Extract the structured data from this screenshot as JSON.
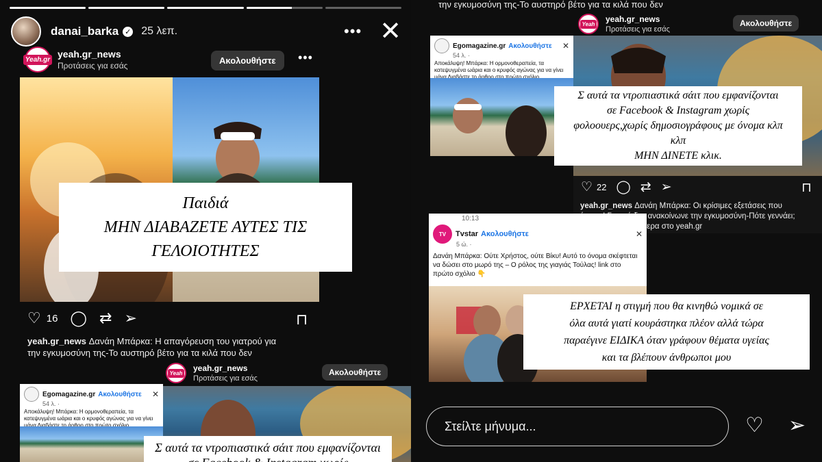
{
  "left_story": {
    "progress": [
      1,
      1,
      1,
      0.6,
      0
    ],
    "user": "danai_barka",
    "time": "25 λεπ.",
    "more": "•••",
    "close": "✕"
  },
  "post1": {
    "user": "yeah.gr_news",
    "subtitle": "Προτάσεις για εσάς",
    "follow": "Ακολουθήστε",
    "more": "•••",
    "logo_text": "Yeah.gr",
    "overlay_lines": [
      "Παιδιά",
      "ΜΗΝ ΔΙΑΒΑΖΕΤΕ ΑΥΤΕΣ ΤΙΣ",
      "ΓΕΛΟΙΟΤΗΤΕΣ"
    ],
    "likes": "16",
    "caption_user": "yeah.gr_news",
    "caption_line1": "Δανάη Μπάρκα: Η απαγόρευση του γιατρού για",
    "caption_line2": "την εγκυμοσύνη της-Το αυστηρό βέτο για τα κιλά που δεν"
  },
  "post2_left": {
    "user": "yeah.gr_news",
    "subtitle": "Προτάσεις για εσάς",
    "follow": "Ακολουθήστε",
    "overlay_line1": "Σ αυτά τα ντροπιαστικά σάιτ που εμφανίζονται",
    "overlay_line2": "σε Facebook & Instagram χωρίς"
  },
  "ego_card": {
    "name": "Egomagazine.gr",
    "follow": "Ακολουθήστε",
    "time": "54 λ. ·",
    "close": "✕",
    "text": "Αποκάλυψη! Μπάρκα: Η ορμονοθεραπεία, τα κατεψυγμένα ωάρια και ο κρυφός αγώνας για να γίνει μάνα Διαβάστε το άρθρο στο πρώτο σχόλιο"
  },
  "right_story": {
    "top_caption": "την εγκυμοσύνη της-Το αυστηρό βέτο για τα κιλά που δεν",
    "post_user": "yeah.gr_news",
    "post_subtitle": "Προτάσεις για εσάς",
    "follow": "Ακολουθήστε",
    "overlay_lines": [
      "Σ αυτά τα ντροπιαστικά σάιτ που εμφανίζονται",
      "σε Facebook & Instagram χωρίς",
      "φολοουερς,χωρίς δημοσιογράφους με όνομα κλπ",
      "κλπ",
      "ΜΗΝ ΔΙΝΕΤΕ κλικ."
    ],
    "likes": "22",
    "caption_user": "yeah.gr_news",
    "caption_line1": "Δανάη Μπάρκα: Οι κρίσιμες εξετάσεις που",
    "caption_line2": "έτρεμε! Γι αυτό δεν ανακοίνωνε την εγκυμοσύνη-Πότε γεννάει;",
    "caption_line3": "Διαβάστε περισσότερα στο yeah.gr"
  },
  "tvstar_card": {
    "status_time": "10:13",
    "name": "Tvstar",
    "follow": "Ακολουθήστε",
    "time": "5 ώ. ·",
    "close": "✕",
    "text": "Δανάη Μπάρκα: Ούτε Χρήστος, ούτε Βίκυ! Αυτό το όνομα σκέφτεται να δώσει στο μωρό της – Ο ρόλος της γιαγιάς Τούλας! link στο πρώτο σχόλιο 👇",
    "overlay_lines": [
      "ΕΡΧΕΤΑΙ η στιγμή που θα κινηθώ νομικά σε",
      "όλα αυτά γιατί κουράστηκα πλέον αλλά τώρα",
      "παραέγινε ΕΙΔΙΚΑ όταν γράφουν θέματα υγείας",
      "και τα βλέπουν άνθρωποι μου"
    ]
  },
  "reply": {
    "placeholder": "Στείλτε μήνυμα..."
  },
  "colors": {
    "brand_pink": "#d2145a",
    "fb_blue": "#1b74e4",
    "follow_bg": "#363636"
  },
  "icons": [
    "heart-icon",
    "comment-icon",
    "repost-icon",
    "send-icon",
    "bookmark-icon",
    "close-icon",
    "more-icon",
    "verified-icon"
  ]
}
